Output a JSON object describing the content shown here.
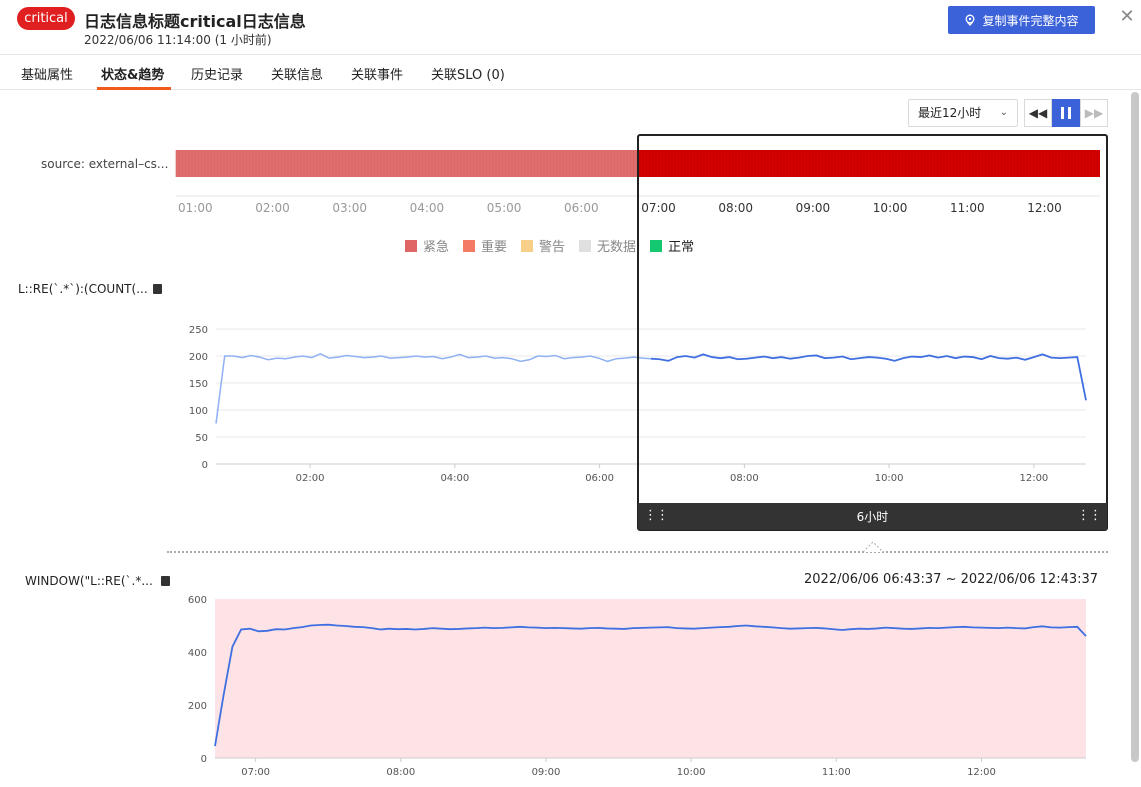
{
  "header": {
    "severity_badge": "critical",
    "title": "日志信息标题critical日志信息",
    "timestamp": "2022/06/06 11:14:00 (1 小时前)",
    "copy_button": "复制事件完整内容",
    "close_label": "✕"
  },
  "tabs": [
    {
      "label": "基础属性",
      "active": false
    },
    {
      "label": "状态&趋势",
      "active": true
    },
    {
      "label": "历史记录",
      "active": false
    },
    {
      "label": "关联信息",
      "active": false
    },
    {
      "label": "关联事件",
      "active": false
    },
    {
      "label": "关联SLO (0)",
      "active": false
    }
  ],
  "controls": {
    "time_range": "最近12小时",
    "caret": "⌄",
    "rewind": "◀◀",
    "forward": "▶▶"
  },
  "status_timeline": {
    "source_label": "source: external–cs...",
    "ticks": [
      "01:00",
      "02:00",
      "03:00",
      "04:00",
      "05:00",
      "06:00",
      "07:00",
      "08:00",
      "09:00",
      "10:00",
      "11:00",
      "12:00"
    ],
    "legend": [
      {
        "label": "紧急",
        "color": "#e06666"
      },
      {
        "label": "重要",
        "color": "#f47a63"
      },
      {
        "label": "警告",
        "color": "#f7cf88"
      },
      {
        "label": "无数据",
        "color": "#e0e0e0"
      },
      {
        "label": "正常",
        "color": "#14c870"
      }
    ],
    "colors": {
      "dim": "#e06f6f",
      "active": "#d40000"
    }
  },
  "metric1": {
    "label": "L::RE(`.*`):(COUNT(..."
  },
  "metric2": {
    "label": "WINDOW(\"L::RE(`.*..."
  },
  "selection": {
    "duration": "6小时",
    "grip": "⋮⋮"
  },
  "window_range": "2022/06/06 06:43:37 ~ 2022/06/06 12:43:37",
  "chart_data": [
    {
      "type": "line",
      "title": "",
      "x_domain_hours": [
        0.7,
        12.72
      ],
      "ylim": [
        0,
        250
      ],
      "yticks": [
        0,
        50,
        100,
        150,
        200,
        250
      ],
      "xticks": [
        "02:00",
        "04:00",
        "06:00",
        "08:00",
        "10:00",
        "12:00"
      ],
      "grid": true,
      "highlight_from_hour": 6.72,
      "series": [
        {
          "values": [
            75,
            200,
            200,
            197,
            201,
            198,
            193,
            196,
            195,
            198,
            200,
            197,
            204,
            196,
            198,
            201,
            199,
            197,
            198,
            200,
            196,
            197,
            198,
            200,
            198,
            199,
            195,
            198,
            203,
            197,
            198,
            200,
            196,
            197,
            195,
            190,
            193,
            200,
            199,
            201,
            195,
            197,
            198,
            200,
            196,
            190,
            195,
            196,
            198,
            196,
            195,
            194,
            191,
            198,
            200,
            197,
            203,
            198,
            196,
            198,
            194,
            195,
            197,
            199,
            196,
            198,
            195,
            197,
            200,
            201,
            196,
            197,
            199,
            194,
            196,
            198,
            197,
            195,
            191,
            196,
            199,
            198,
            201,
            197,
            200,
            196,
            199,
            198,
            194,
            200,
            196,
            195,
            197,
            193,
            198,
            203,
            197,
            196,
            197,
            198,
            118
          ]
        }
      ]
    },
    {
      "type": "area",
      "title": "",
      "x_domain_hours": [
        6.72,
        12.72
      ],
      "ylim": [
        0,
        600
      ],
      "yticks": [
        0,
        200,
        400,
        600
      ],
      "xticks": [
        "07:00",
        "08:00",
        "09:00",
        "10:00",
        "11:00",
        "12:00"
      ],
      "grid": false,
      "background": "#fde3e6",
      "series": [
        {
          "values": [
            45,
            240,
            420,
            485,
            488,
            478,
            480,
            486,
            485,
            490,
            494,
            500,
            502,
            503,
            500,
            498,
            495,
            494,
            490,
            485,
            488,
            486,
            487,
            485,
            487,
            490,
            488,
            486,
            487,
            489,
            490,
            492,
            490,
            491,
            493,
            495,
            493,
            492,
            490,
            491,
            490,
            489,
            488,
            490,
            491,
            489,
            488,
            487,
            490,
            491,
            492,
            493,
            494,
            490,
            489,
            488,
            490,
            492,
            494,
            495,
            498,
            500,
            497,
            495,
            493,
            490,
            488,
            489,
            490,
            491,
            489,
            486,
            483,
            486,
            488,
            487,
            489,
            492,
            490,
            488,
            487,
            489,
            491,
            490,
            492,
            494,
            495,
            493,
            492,
            491,
            490,
            492,
            490,
            489,
            494,
            497,
            493,
            492,
            494,
            495,
            460
          ]
        }
      ]
    }
  ]
}
